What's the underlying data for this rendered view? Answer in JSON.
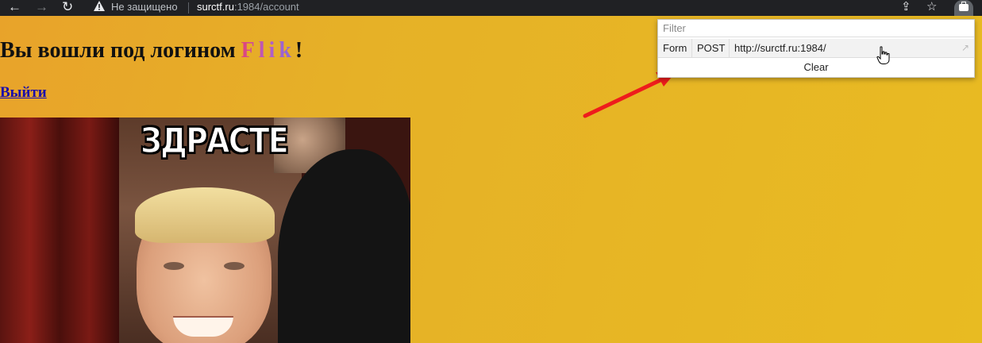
{
  "browser": {
    "nav": {
      "back": "←",
      "forward": "→",
      "reload": "↻"
    },
    "security_icon": "warning-icon",
    "security_text": "Не защищено",
    "url_host": "surctf.ru",
    "url_path": ":1984/account",
    "share_glyph": "⇪",
    "star_glyph": "☆"
  },
  "page": {
    "heading_prefix": "Вы вошли под логином ",
    "login_name": "Flik",
    "heading_suffix": "!",
    "logout_label": "Выйти",
    "meme_caption": "ЗДРАСТЕ"
  },
  "popup": {
    "filter_placeholder": "Filter",
    "rows": [
      {
        "type": "Form",
        "method": "POST",
        "url": "http://surctf.ru:1984/",
        "open_glyph": "↗"
      }
    ],
    "clear_label": "Clear"
  },
  "colors": {
    "page_background": "#e6b127",
    "arrow": "#ee1c1c",
    "link": "#1a0dab"
  }
}
